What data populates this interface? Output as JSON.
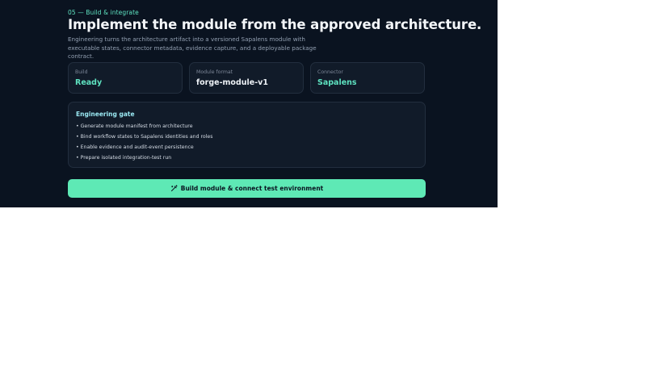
{
  "header": {
    "step": "05 — Build & integrate",
    "title": "Implement the module from the approved architecture.",
    "subtitle": "Engineering turns the architecture artifact into a versioned Sapalens module with executable states, connector metadata, evidence capture, and a deployable package contract."
  },
  "cards": [
    {
      "label": "Build",
      "value": "Ready"
    },
    {
      "label": "Module format",
      "value": "forge-module-v1"
    },
    {
      "label": "Connector",
      "value": "Sapalens"
    }
  ],
  "gate": {
    "title": "Engineering gate",
    "items": [
      "• Generate module manifest from architecture",
      "• Bind workflow states to Sapalens identities and roles",
      "• Enable evidence and audit-event persistence",
      "• Prepare isolated integration-test run"
    ]
  },
  "cta": {
    "icon": "wand-icon",
    "label": "Build module & connect test environment"
  },
  "colors": {
    "background": "#0a1320",
    "accent": "#5ee2c0",
    "button": "#5ee9b5"
  }
}
